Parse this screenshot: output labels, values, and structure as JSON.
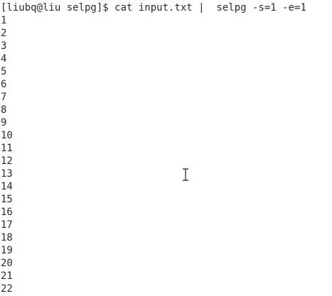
{
  "terminal": {
    "prompt": "[liubq@liu selpg]$",
    "command": "cat input.txt |  selpg -s=1 -e=1",
    "output": [
      "1",
      "2",
      "3",
      "4",
      "5",
      "6",
      "7",
      "8",
      "9",
      "10",
      "11",
      "12",
      "13",
      "14",
      "15",
      "16",
      "17",
      "18",
      "19",
      "20",
      "21",
      "22"
    ]
  },
  "colors": {
    "background": "#ffffff",
    "text": "#2b2b2b"
  },
  "icons": {
    "mouse_cursor": "i-beam-cursor-icon"
  }
}
